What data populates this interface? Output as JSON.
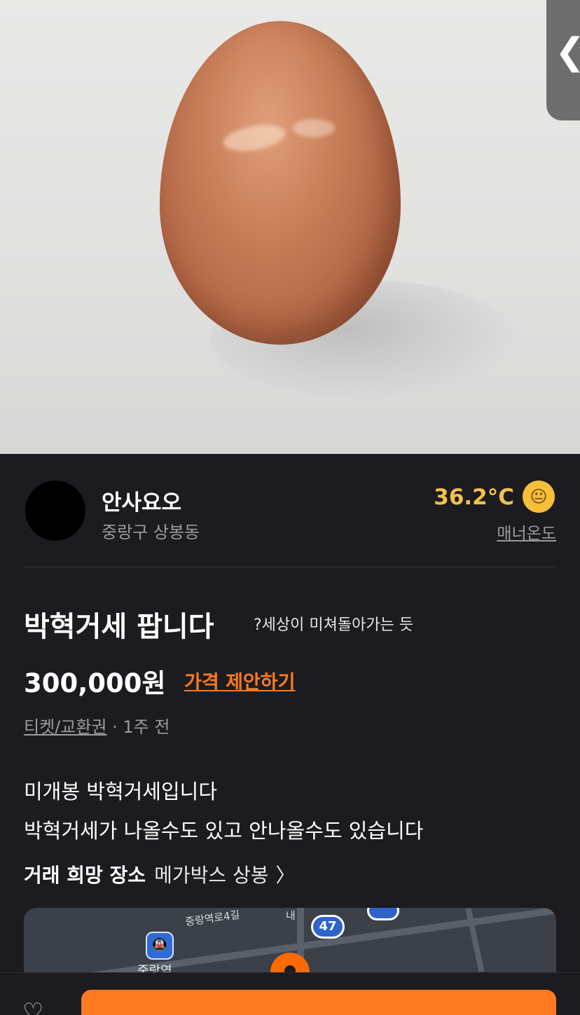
{
  "photo": {
    "description_icon": "egg-photo",
    "back_chevron": "❮"
  },
  "seller": {
    "name": "안사요오",
    "location": "중랑구 상봉동",
    "temperature": "36.2°C",
    "temperature_face": "😐",
    "manner_label": "매너온도"
  },
  "post": {
    "title": "박혁거세 팝니다",
    "subnote": "?세상이 미쳐돌아가는 듯",
    "price": "300,000원",
    "offer_label": "가격 제안하기",
    "category": "티켓/교환권",
    "time": " · 1주 전",
    "description_line1": "미개봉 박혁거세입니다",
    "description_line2": "박혁거세가 나올수도 있고 안나올수도 있습니다"
  },
  "place": {
    "label": "거래 희망 장소",
    "value": "메가박스 상봉",
    "chevron": "〉"
  },
  "map": {
    "road_label": "중랑역로4길",
    "road_label2": "내",
    "route_badge": "47",
    "station_name": "중랑역",
    "station_icon": "🚇"
  },
  "bottom": {
    "heart_icon": "♡"
  },
  "colors": {
    "accent": "#ff7a20",
    "temperature": "#f3c14a",
    "background": "#1c1c20"
  }
}
